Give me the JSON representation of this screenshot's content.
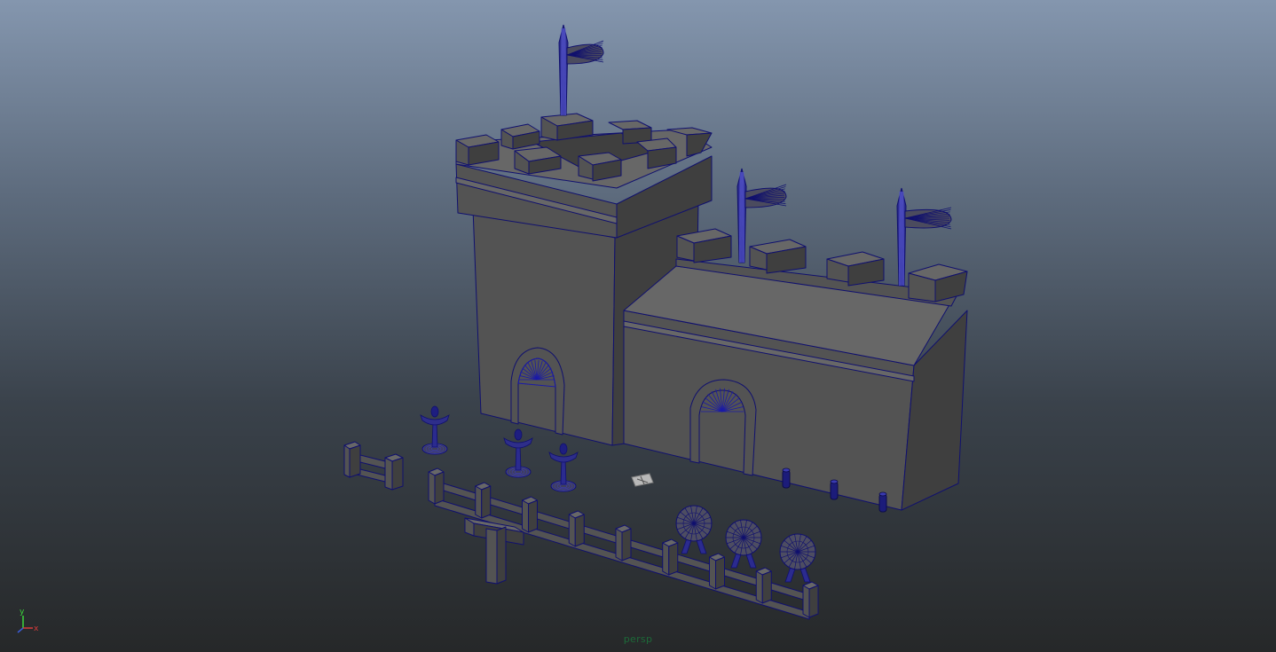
{
  "viewport": {
    "camera_label": "persp",
    "camera_label_color": "#1d6a39",
    "background_top": "#8496ae",
    "background_bottom": "#262829"
  },
  "axis_gizmo": {
    "y_label": "y",
    "x_label": "x",
    "y_color": "#3bd63b",
    "x_color": "#d63b3b",
    "z_color": "#3b5bd6"
  },
  "scene": {
    "mesh_fill": "#535353",
    "mesh_fill_light": "#676767",
    "mesh_fill_dark": "#3f3f3f",
    "wireframe_color": "#10106e",
    "selected_wire_color": "#1a1aa8",
    "objects": [
      "castle-tower",
      "castle-keep",
      "tower-flag",
      "keep-flag-left",
      "keep-flag-right",
      "tower-door-arch",
      "keep-door-arch",
      "short-fence",
      "long-fence",
      "signpost",
      "candle-stand-1",
      "candle-stand-2",
      "candle-stand-3",
      "wheel-prop-1",
      "wheel-prop-2",
      "wheel-prop-3",
      "post-1",
      "post-2",
      "post-3",
      "ground-marker"
    ]
  }
}
